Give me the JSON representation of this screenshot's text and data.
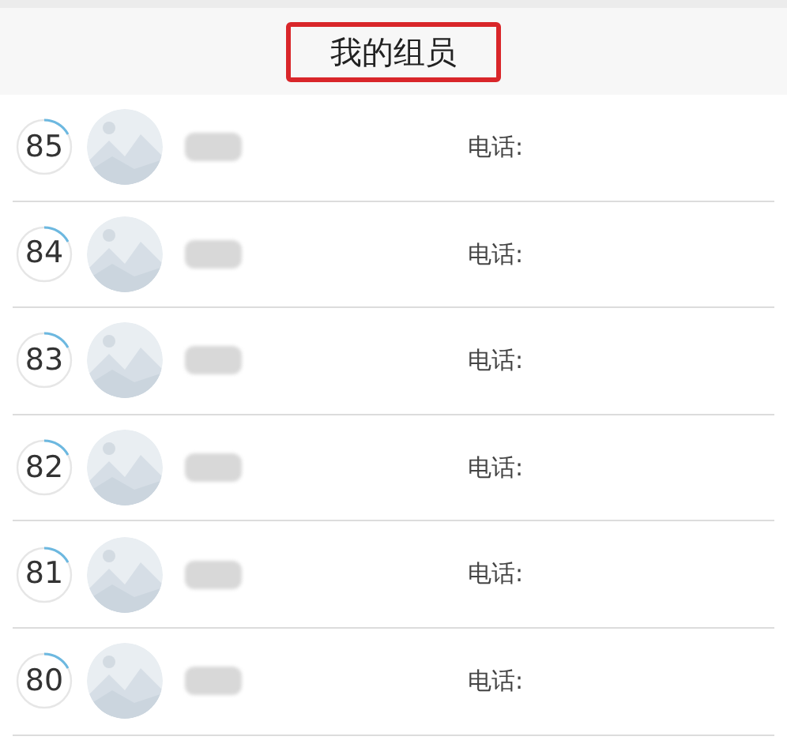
{
  "header": {
    "title": "我的组员"
  },
  "members": [
    {
      "score": "85",
      "phone_label": "电话:"
    },
    {
      "score": "84",
      "phone_label": "电话:"
    },
    {
      "score": "83",
      "phone_label": "电话:"
    },
    {
      "score": "82",
      "phone_label": "电话:"
    },
    {
      "score": "81",
      "phone_label": "电话:"
    },
    {
      "score": "80",
      "phone_label": "电话:"
    }
  ]
}
